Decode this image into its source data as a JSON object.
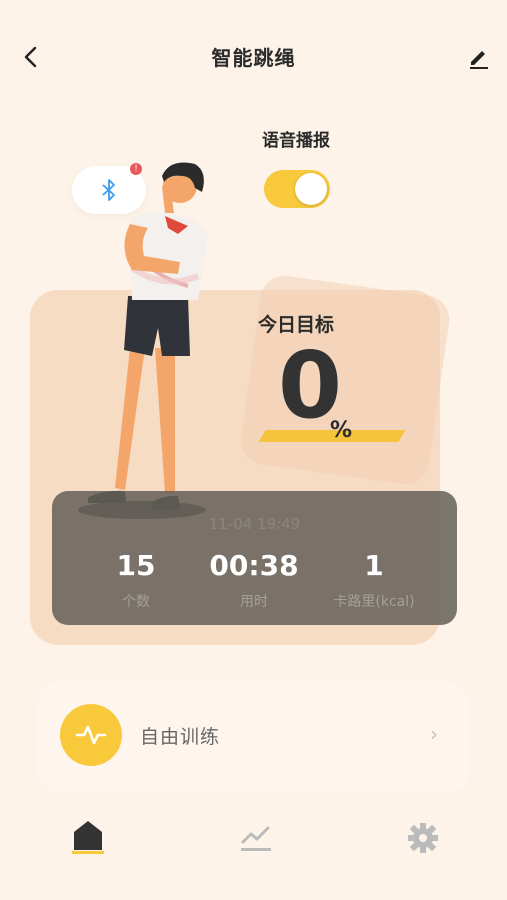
{
  "header": {
    "title": "智能跳绳"
  },
  "voice": {
    "label": "语音播报",
    "enabled": true
  },
  "goal": {
    "label": "今日目标",
    "value": "0",
    "unit": "%"
  },
  "session": {
    "timestamp": "11-04 19:49",
    "stats": [
      {
        "value": "15",
        "label": "个数"
      },
      {
        "value": "00:38",
        "label": "用时"
      },
      {
        "value": "1",
        "label": "卡路里(kcal)"
      }
    ]
  },
  "free_training": {
    "label": "自由训练"
  },
  "bluetooth": {
    "badge": "!"
  },
  "icons": {
    "back": "back-arrow-icon",
    "edit": "edit-icon",
    "bluetooth": "bluetooth-icon",
    "pulse": "pulse-icon",
    "home": "home-icon",
    "chart": "chart-icon",
    "settings": "gear-icon"
  },
  "colors": {
    "accent": "#f8c93a",
    "background": "#fdf3e8",
    "panel": "#645f58"
  }
}
